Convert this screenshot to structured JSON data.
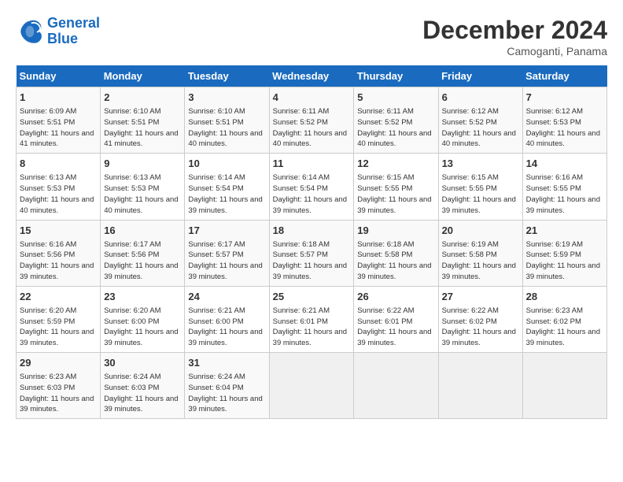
{
  "header": {
    "logo_line1": "General",
    "logo_line2": "Blue",
    "month": "December 2024",
    "location": "Camoganti, Panama"
  },
  "days_of_week": [
    "Sunday",
    "Monday",
    "Tuesday",
    "Wednesday",
    "Thursday",
    "Friday",
    "Saturday"
  ],
  "weeks": [
    [
      {
        "num": "1",
        "sunrise": "6:09 AM",
        "sunset": "5:51 PM",
        "daylight": "11 hours and 41 minutes."
      },
      {
        "num": "2",
        "sunrise": "6:10 AM",
        "sunset": "5:51 PM",
        "daylight": "11 hours and 41 minutes."
      },
      {
        "num": "3",
        "sunrise": "6:10 AM",
        "sunset": "5:51 PM",
        "daylight": "11 hours and 40 minutes."
      },
      {
        "num": "4",
        "sunrise": "6:11 AM",
        "sunset": "5:52 PM",
        "daylight": "11 hours and 40 minutes."
      },
      {
        "num": "5",
        "sunrise": "6:11 AM",
        "sunset": "5:52 PM",
        "daylight": "11 hours and 40 minutes."
      },
      {
        "num": "6",
        "sunrise": "6:12 AM",
        "sunset": "5:52 PM",
        "daylight": "11 hours and 40 minutes."
      },
      {
        "num": "7",
        "sunrise": "6:12 AM",
        "sunset": "5:53 PM",
        "daylight": "11 hours and 40 minutes."
      }
    ],
    [
      {
        "num": "8",
        "sunrise": "6:13 AM",
        "sunset": "5:53 PM",
        "daylight": "11 hours and 40 minutes."
      },
      {
        "num": "9",
        "sunrise": "6:13 AM",
        "sunset": "5:53 PM",
        "daylight": "11 hours and 40 minutes."
      },
      {
        "num": "10",
        "sunrise": "6:14 AM",
        "sunset": "5:54 PM",
        "daylight": "11 hours and 39 minutes."
      },
      {
        "num": "11",
        "sunrise": "6:14 AM",
        "sunset": "5:54 PM",
        "daylight": "11 hours and 39 minutes."
      },
      {
        "num": "12",
        "sunrise": "6:15 AM",
        "sunset": "5:55 PM",
        "daylight": "11 hours and 39 minutes."
      },
      {
        "num": "13",
        "sunrise": "6:15 AM",
        "sunset": "5:55 PM",
        "daylight": "11 hours and 39 minutes."
      },
      {
        "num": "14",
        "sunrise": "6:16 AM",
        "sunset": "5:55 PM",
        "daylight": "11 hours and 39 minutes."
      }
    ],
    [
      {
        "num": "15",
        "sunrise": "6:16 AM",
        "sunset": "5:56 PM",
        "daylight": "11 hours and 39 minutes."
      },
      {
        "num": "16",
        "sunrise": "6:17 AM",
        "sunset": "5:56 PM",
        "daylight": "11 hours and 39 minutes."
      },
      {
        "num": "17",
        "sunrise": "6:17 AM",
        "sunset": "5:57 PM",
        "daylight": "11 hours and 39 minutes."
      },
      {
        "num": "18",
        "sunrise": "6:18 AM",
        "sunset": "5:57 PM",
        "daylight": "11 hours and 39 minutes."
      },
      {
        "num": "19",
        "sunrise": "6:18 AM",
        "sunset": "5:58 PM",
        "daylight": "11 hours and 39 minutes."
      },
      {
        "num": "20",
        "sunrise": "6:19 AM",
        "sunset": "5:58 PM",
        "daylight": "11 hours and 39 minutes."
      },
      {
        "num": "21",
        "sunrise": "6:19 AM",
        "sunset": "5:59 PM",
        "daylight": "11 hours and 39 minutes."
      }
    ],
    [
      {
        "num": "22",
        "sunrise": "6:20 AM",
        "sunset": "5:59 PM",
        "daylight": "11 hours and 39 minutes."
      },
      {
        "num": "23",
        "sunrise": "6:20 AM",
        "sunset": "6:00 PM",
        "daylight": "11 hours and 39 minutes."
      },
      {
        "num": "24",
        "sunrise": "6:21 AM",
        "sunset": "6:00 PM",
        "daylight": "11 hours and 39 minutes."
      },
      {
        "num": "25",
        "sunrise": "6:21 AM",
        "sunset": "6:01 PM",
        "daylight": "11 hours and 39 minutes."
      },
      {
        "num": "26",
        "sunrise": "6:22 AM",
        "sunset": "6:01 PM",
        "daylight": "11 hours and 39 minutes."
      },
      {
        "num": "27",
        "sunrise": "6:22 AM",
        "sunset": "6:02 PM",
        "daylight": "11 hours and 39 minutes."
      },
      {
        "num": "28",
        "sunrise": "6:23 AM",
        "sunset": "6:02 PM",
        "daylight": "11 hours and 39 minutes."
      }
    ],
    [
      {
        "num": "29",
        "sunrise": "6:23 AM",
        "sunset": "6:03 PM",
        "daylight": "11 hours and 39 minutes."
      },
      {
        "num": "30",
        "sunrise": "6:24 AM",
        "sunset": "6:03 PM",
        "daylight": "11 hours and 39 minutes."
      },
      {
        "num": "31",
        "sunrise": "6:24 AM",
        "sunset": "6:04 PM",
        "daylight": "11 hours and 39 minutes."
      },
      null,
      null,
      null,
      null
    ]
  ]
}
